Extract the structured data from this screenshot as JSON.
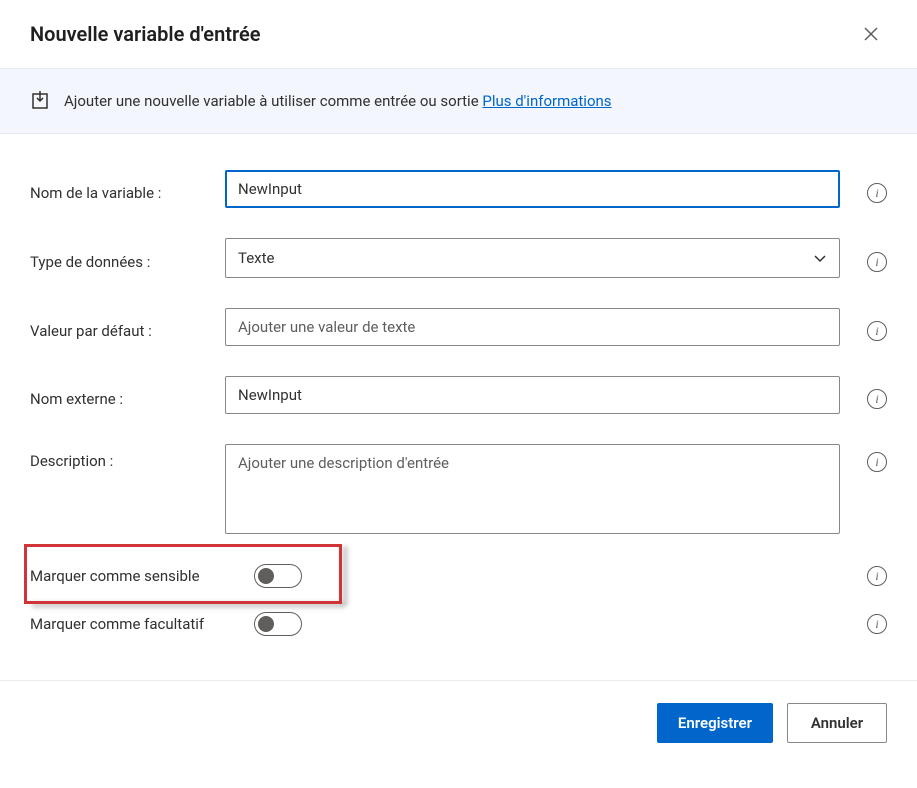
{
  "dialog": {
    "title": "Nouvelle variable d'entrée",
    "close_name": "close"
  },
  "banner": {
    "text": "Ajouter une nouvelle variable à utiliser comme entrée ou sortie ",
    "link": "Plus d'informations"
  },
  "fields": {
    "variable_name": {
      "label": "Nom de la variable :",
      "value": "NewInput"
    },
    "data_type": {
      "label": "Type de données :",
      "value": "Texte"
    },
    "default_value": {
      "label": "Valeur par défaut :",
      "placeholder": "Ajouter une valeur de texte",
      "value": ""
    },
    "external_name": {
      "label": "Nom externe :",
      "value": "NewInput"
    },
    "description": {
      "label": "Description :",
      "placeholder": "Ajouter une description d'entrée",
      "value": ""
    },
    "sensitive": {
      "label": "Marquer comme sensible",
      "value": false
    },
    "optional": {
      "label": "Marquer comme facultatif",
      "value": false
    }
  },
  "buttons": {
    "save": "Enregistrer",
    "cancel": "Annuler"
  },
  "highlight": {
    "target": "sensitive-row"
  }
}
